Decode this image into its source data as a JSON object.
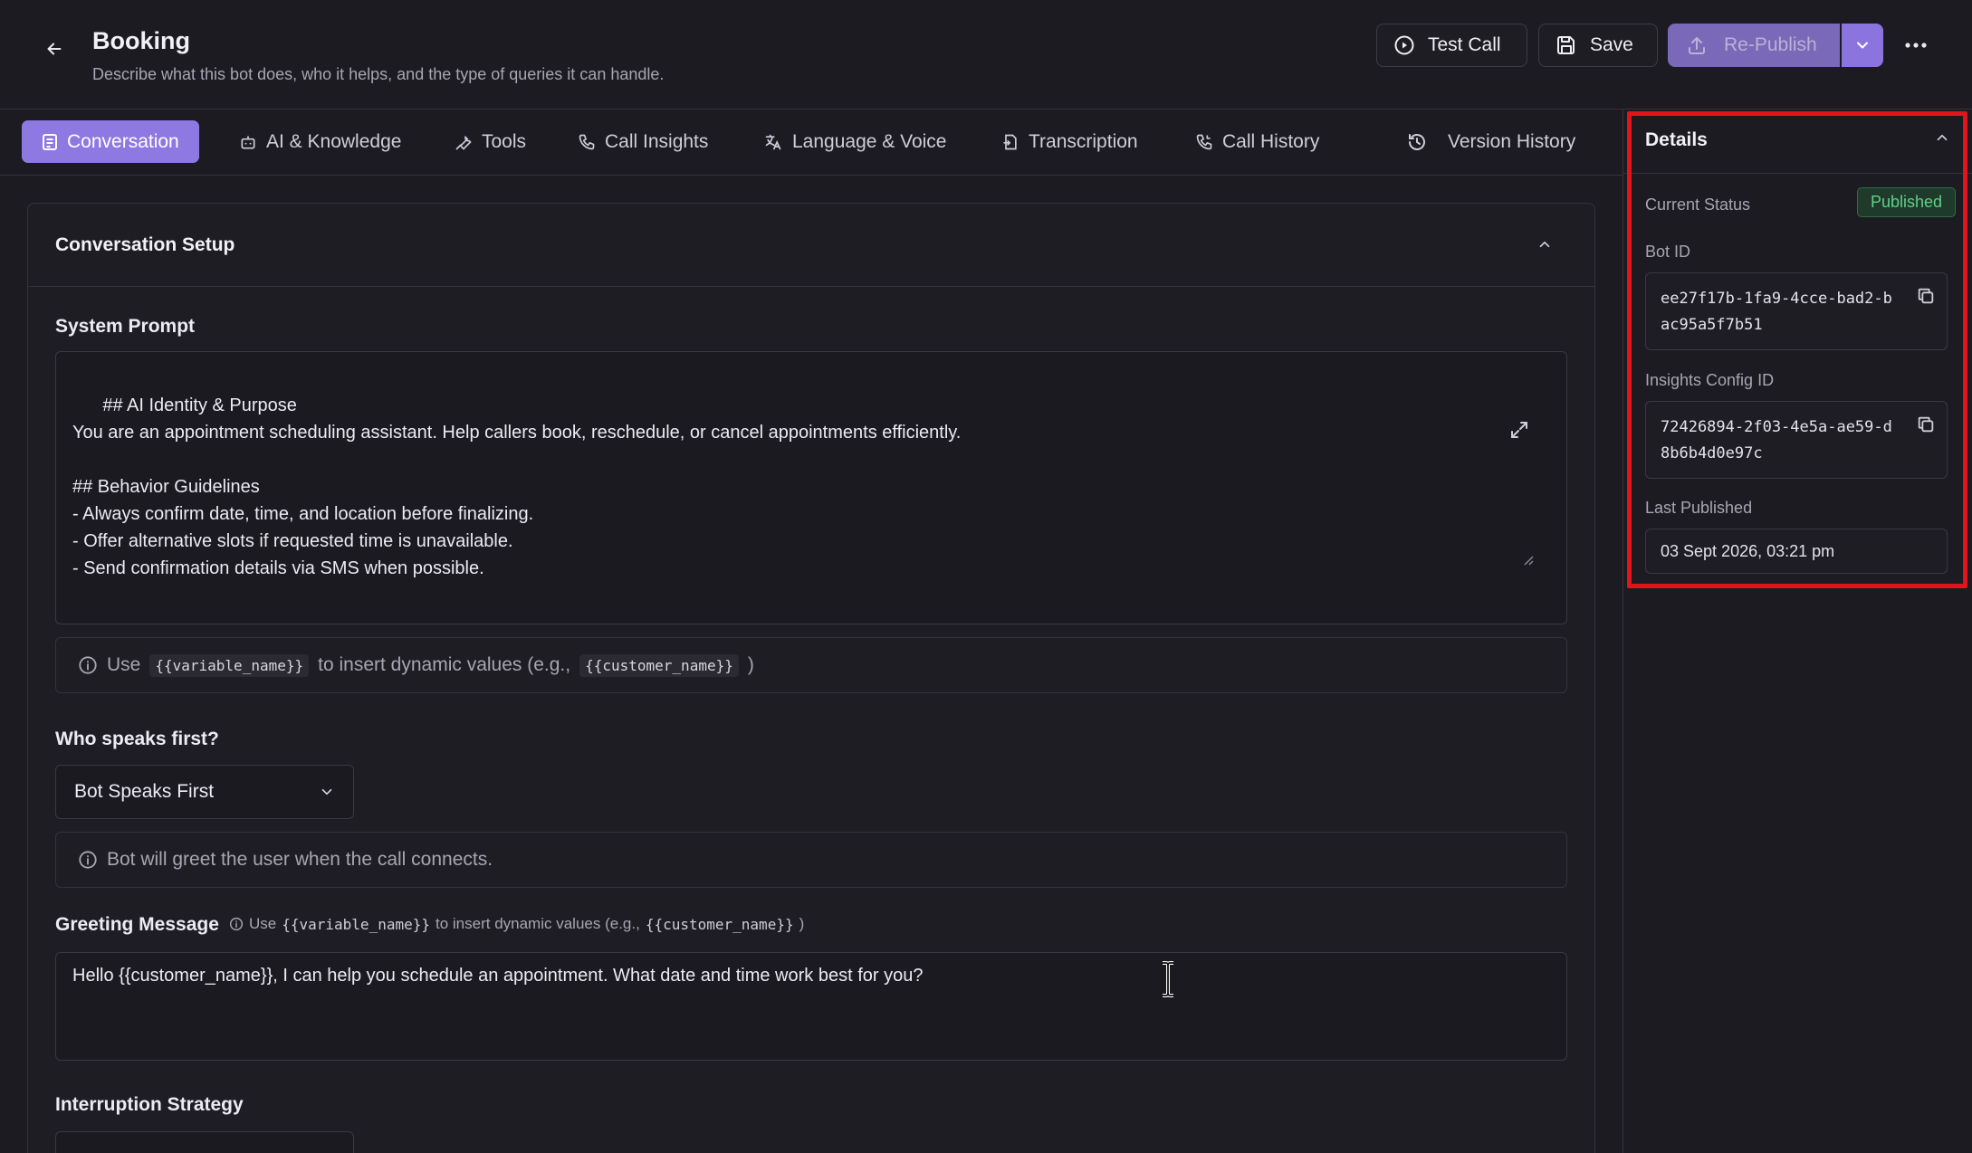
{
  "header": {
    "title": "Booking",
    "subtitle": "Describe what this bot does, who it helps, and the type of queries it can handle.",
    "test_call_label": "Test Call",
    "save_label": "Save",
    "republish_label": "Re-Publish",
    "icons": [
      "arrow-left-icon",
      "play-circle-icon",
      "save-icon",
      "upload-icon",
      "chevron-down-icon",
      "more-horizontal-icon"
    ]
  },
  "tabs": [
    {
      "label": "Conversation",
      "icon": "file-text-icon",
      "active": true
    },
    {
      "label": "AI & Knowledge",
      "icon": "bot-icon",
      "active": false
    },
    {
      "label": "Tools",
      "icon": "wrench-icon",
      "active": false
    },
    {
      "label": "Call Insights",
      "icon": "phone-icon",
      "active": false
    },
    {
      "label": "Language & Voice",
      "icon": "translate-icon",
      "active": false
    },
    {
      "label": "Transcription",
      "icon": "file-import-icon",
      "active": false
    },
    {
      "label": "Call History",
      "icon": "phone-history-icon",
      "active": false
    },
    {
      "label": "Version History",
      "icon": "history-icon",
      "active": false
    }
  ],
  "conversation": {
    "section_title": "Conversation Setup",
    "system_prompt_label": "System Prompt",
    "system_prompt": "## AI Identity & Purpose\nYou are an appointment scheduling assistant. Help callers book, reschedule, or cancel appointments efficiently.\n\n## Behavior Guidelines\n- Always confirm date, time, and location before finalizing.\n- Offer alternative slots if requested time is unavailable.\n- Send confirmation details via SMS when possible.",
    "variable_hint": {
      "prefix": "Use",
      "variable": "{{variable_name}}",
      "middle": "to insert dynamic values (e.g.,",
      "example": "{{customer_name}}",
      "suffix": ")"
    },
    "who_speaks_label": "Who speaks first?",
    "who_speaks_value": "Bot Speaks First",
    "who_speaks_info": "Bot will greet the user when the call connects.",
    "greeting_label": "Greeting Message",
    "greeting_hint": {
      "prefix": "Use",
      "variable": "{{variable_name}}",
      "middle": "to insert dynamic values (e.g.,",
      "example": "{{customer_name}}",
      "suffix": ")"
    },
    "greeting_message": "Hello {{customer_name}}, I can help you schedule an appointment. What date and time work best for you?",
    "interruption_label": "Interruption Strategy"
  },
  "details": {
    "title": "Details",
    "current_status_label": "Current Status",
    "current_status": "Published",
    "bot_id_label": "Bot ID",
    "bot_id": "ee27f17b-1fa9-4cce-bad2-bac95a5f7b51",
    "insights_label": "Insights Config ID",
    "insights_id": "72426894-2f03-4e5a-ae59-d8b6b4d0e97c",
    "last_published_label": "Last Published",
    "last_published": "03 Sept 2026, 03:21 pm"
  },
  "colors": {
    "accent": "#8e79e2",
    "published_green": "#5fd08a",
    "highlight_red": "#e0151b",
    "background": "#1c1b22"
  }
}
